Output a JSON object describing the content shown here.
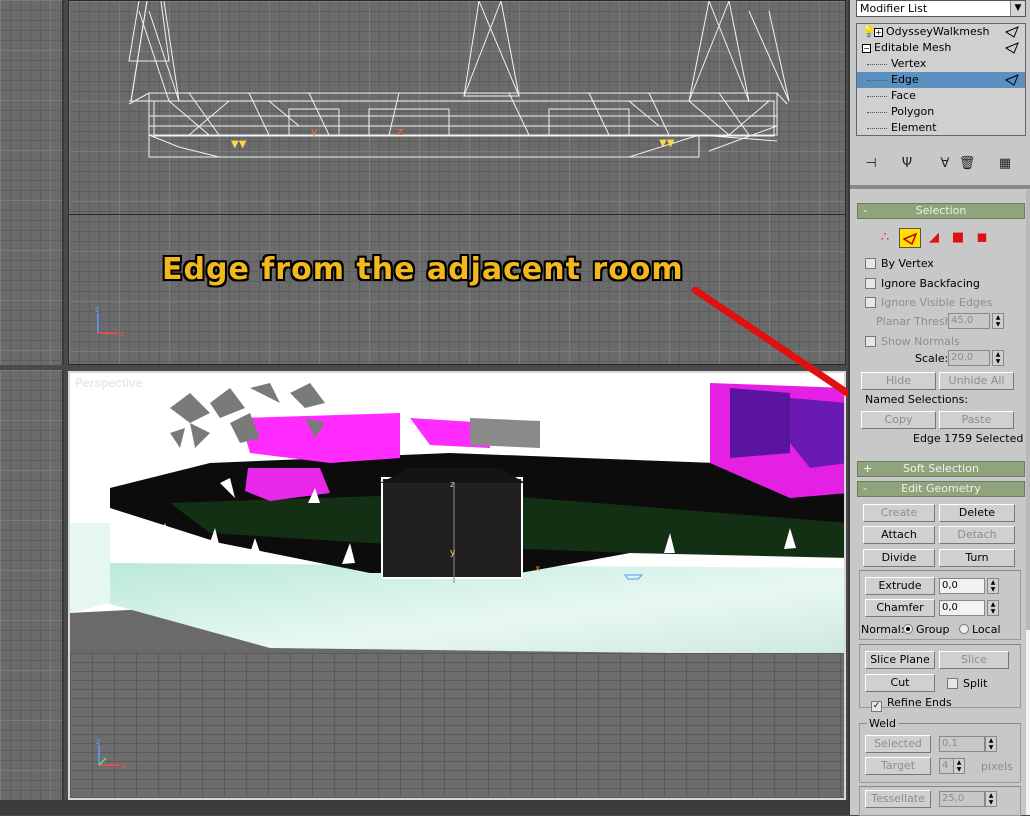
{
  "viewports": {
    "perspective_label": "Perspective"
  },
  "annotation": {
    "callout_text": "Edge from the adjacent room",
    "arrow_color": "#e01010",
    "text_color": "#f3b81e"
  },
  "modifier_panel": {
    "modifier_list_label": "Modifier List",
    "stack": [
      {
        "label": "OdysseyWalkmesh",
        "level": 0
      },
      {
        "label": "Editable Mesh",
        "level": 0
      },
      {
        "label": "Vertex",
        "level": 1
      },
      {
        "label": "Edge",
        "level": 1
      },
      {
        "label": "Face",
        "level": 1
      },
      {
        "label": "Polygon",
        "level": 1
      },
      {
        "label": "Element",
        "level": 1
      }
    ],
    "selected_item": "Edge",
    "toolbar_icons": [
      "pin-stack-icon",
      "show-end-result-icon",
      "make-unique-icon",
      "remove-modifier-icon",
      "configure-sets-icon"
    ]
  },
  "selection": {
    "header": "Selection",
    "subobject_icons": [
      "vertex-icon",
      "edge-icon",
      "face-icon",
      "polygon-icon",
      "element-icon"
    ],
    "by_vertex": "By Vertex",
    "ignore_backfacing": "Ignore Backfacing",
    "ignore_visible_edges": "Ignore Visible Edges",
    "planar_thresh_label": "Planar Thresh:",
    "planar_thresh_value": "45,0",
    "show_normals": "Show Normals",
    "scale_label": "Scale:",
    "scale_value": "20,0",
    "hide": "Hide",
    "unhide_all": "Unhide All",
    "named_selections": "Named Selections:",
    "copy": "Copy",
    "paste": "Paste",
    "status": "Edge 1759 Selected"
  },
  "soft_selection": {
    "header": "Soft Selection"
  },
  "edit_geometry": {
    "header": "Edit Geometry",
    "create": "Create",
    "delete": "Delete",
    "attach": "Attach",
    "detach": "Detach",
    "divide": "Divide",
    "turn": "Turn",
    "extrude": "Extrude",
    "extrude_value": "0,0",
    "chamfer": "Chamfer",
    "chamfer_value": "0,0",
    "normal_label": "Normal:",
    "group": "Group",
    "local": "Local",
    "slice_plane": "Slice Plane",
    "slice": "Slice",
    "cut": "Cut",
    "split": "Split",
    "refine_ends": "Refine Ends",
    "weld_label": "Weld",
    "selected": "Selected",
    "selected_value": "0,1",
    "target": "Target",
    "target_value": "4",
    "pixels": "pixels",
    "tessellate": "Tessellate",
    "tessellate_value": "25,0"
  }
}
